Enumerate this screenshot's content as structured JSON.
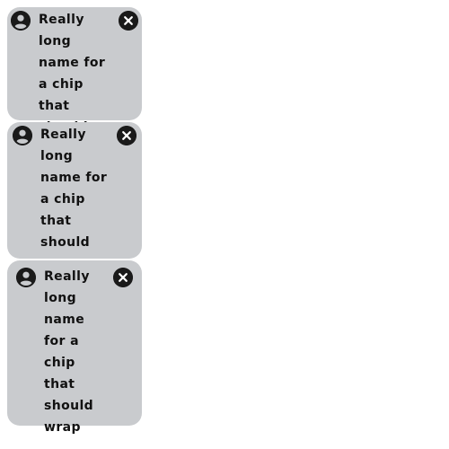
{
  "chips": [
    {
      "label": "Really long name for a chip that should wrap",
      "avatar_icon": "account-circle-icon",
      "close_icon": "close-circle-icon"
    },
    {
      "label": "Really long name for a chip that should wrap",
      "avatar_icon": "account-circle-icon",
      "close_icon": "close-circle-icon"
    },
    {
      "label": "Really long name for a chip that should wrap",
      "avatar_icon": "account-circle-icon",
      "close_icon": "close-circle-icon"
    }
  ],
  "colors": {
    "chip_background": "#c9cbce",
    "icon_fill": "#1a1a1a",
    "text": "#111111"
  }
}
